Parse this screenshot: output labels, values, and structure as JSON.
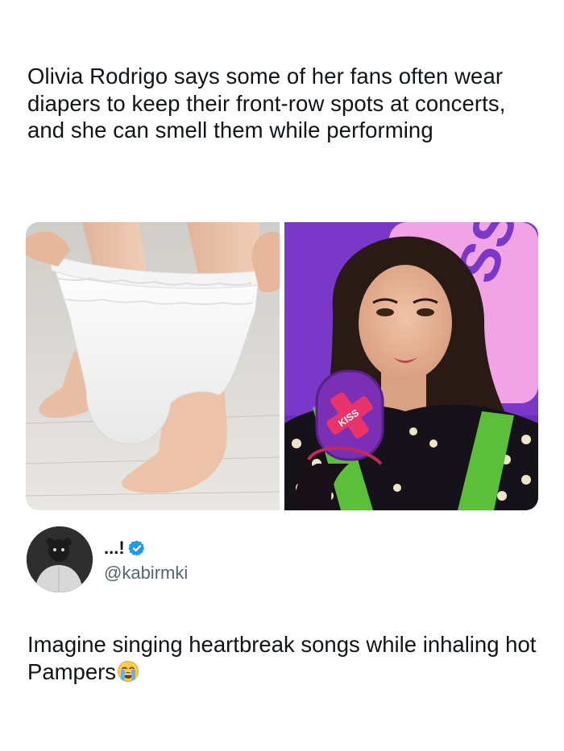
{
  "post": {
    "headline": "Olivia Rodrigo says some of her fans often wear diapers to keep their front-row spots at concerts, and she can smell them while performing"
  },
  "media": {
    "left_image": "diaper-photo",
    "right_image": "interview-photo",
    "mic_flag_text": "KISS"
  },
  "author": {
    "display_name": "...!",
    "handle": "@kabirmki",
    "verified": true,
    "verified_color": "#1d9bf0"
  },
  "reply": {
    "text": "Imagine singing heartbreak songs while inhaling hot Pampers",
    "emoji": "loudly-crying-face-icon"
  }
}
